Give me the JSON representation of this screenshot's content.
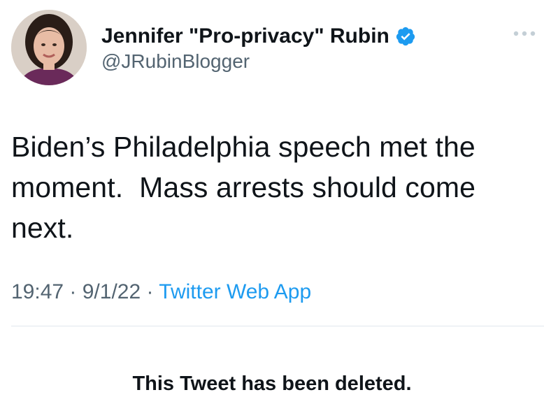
{
  "tweet": {
    "author": {
      "display_name": "Jennifer \"Pro-privacy\" Rubin",
      "handle": "@JRubinBlogger",
      "verified": true,
      "avatar_icon": "profile-photo"
    },
    "text": "Biden’s Philadelphia speech met the\nmoment.  Mass arrests should come\nnext.",
    "meta": {
      "time": "19:47",
      "separator": " · ",
      "date": "9/1/22",
      "source": "Twitter Web App"
    },
    "more_icon": "more-horizontal-icon"
  },
  "notice": "This Tweet has been deleted.",
  "colors": {
    "text": "#0f1419",
    "secondary": "#536471",
    "accent": "#1d9bf0",
    "divider": "#e1e8ed"
  }
}
